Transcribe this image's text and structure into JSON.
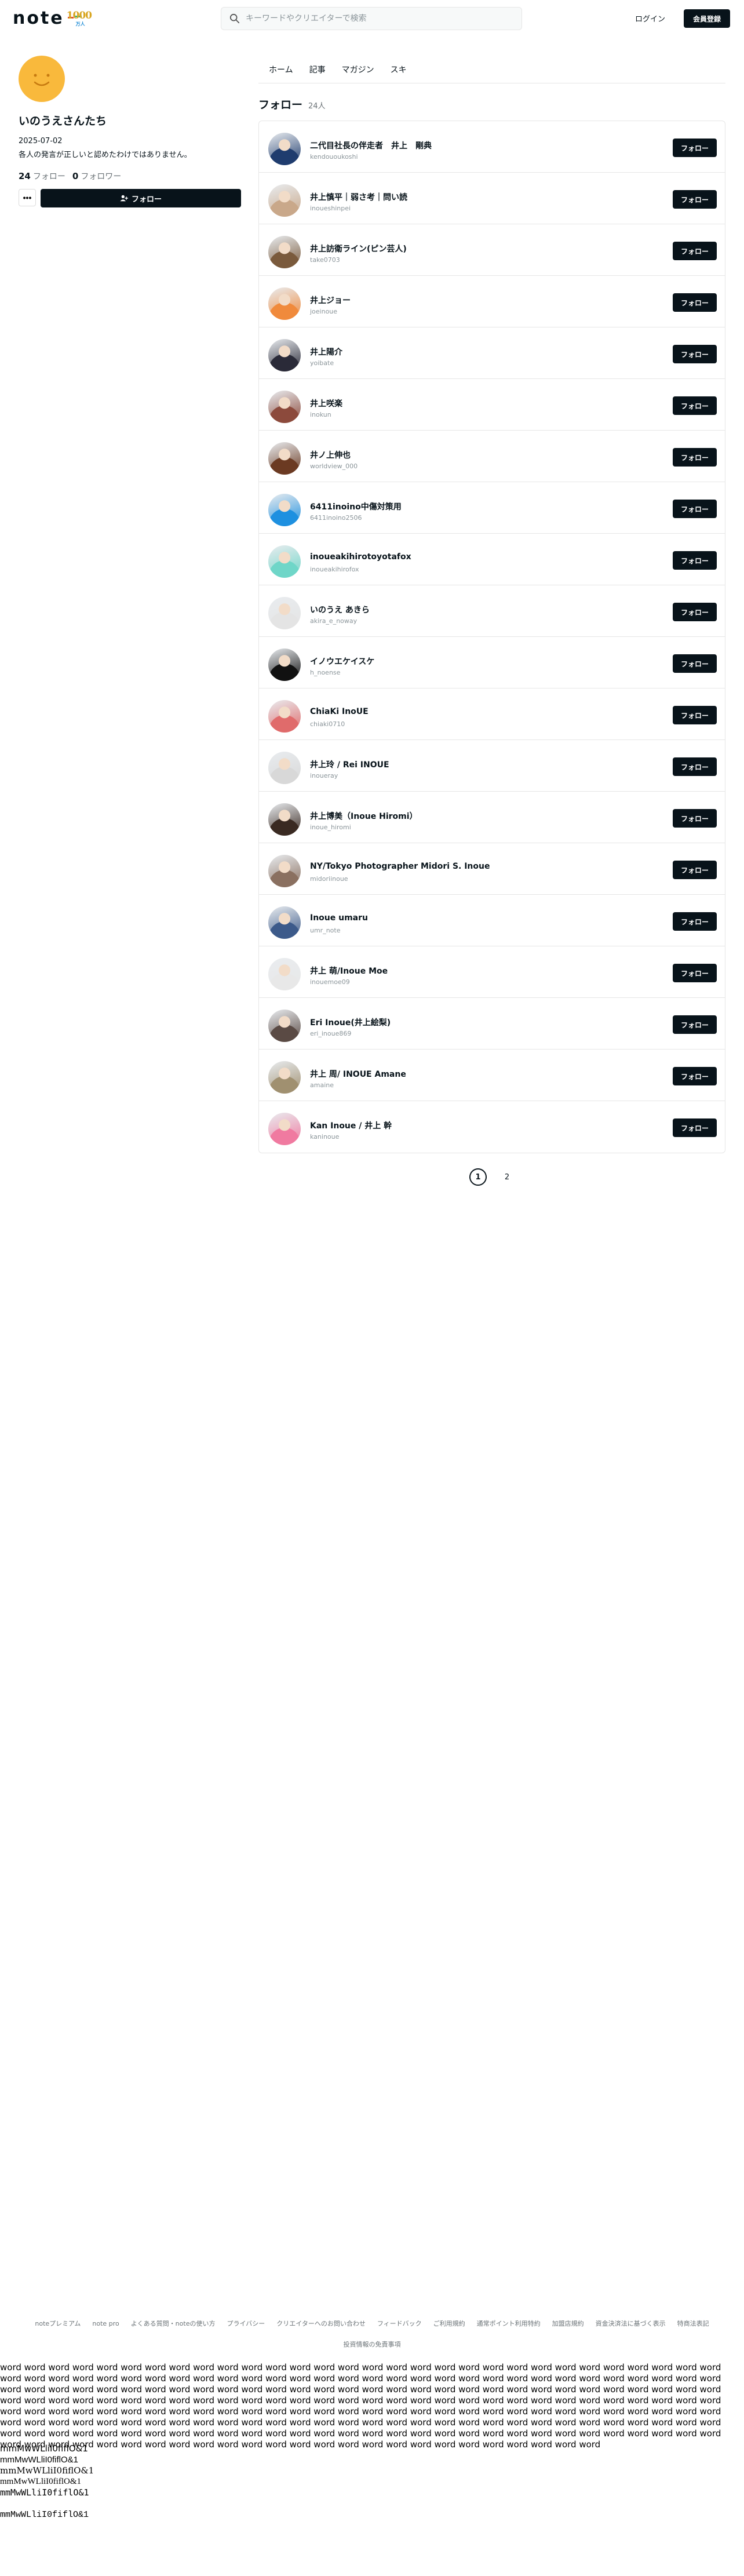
{
  "header": {
    "logo_text": "note",
    "logo_badge_num": "1000",
    "logo_badge_sub": "万人",
    "search_placeholder": "キーワードやクリエイターで検索",
    "login_label": "ログイン",
    "signup_label": "会員登録"
  },
  "profile": {
    "name": "いのうえさんたち",
    "date": "2025-07-02",
    "bio": "各人の発言が正しいと認めたわけではありません。",
    "following_count": "24",
    "following_label": "フォロー",
    "followers_count": "0",
    "followers_label": "フォロワー",
    "more_label": "•••",
    "follow_label": "フォロー"
  },
  "tabs": [
    "ホーム",
    "記事",
    "マガジン",
    "スキ"
  ],
  "section": {
    "title": "フォロー",
    "count": "24人"
  },
  "follow_button_label": "フォロー",
  "follows": [
    {
      "name": "二代目社長の伴走者　井上　剛典",
      "id": "kendououkoshi",
      "avatar_color": "#1f3c6e"
    },
    {
      "name": "井上慎平｜弱さ考｜問い読",
      "id": "inoueshinpei",
      "avatar_color": "#c9a88a"
    },
    {
      "name": "井上訪衛ライン(ピン芸人)",
      "id": "take0703",
      "avatar_color": "#7a5a3c"
    },
    {
      "name": "井上ジョー",
      "id": "joeinoue",
      "avatar_color": "#f08a3c"
    },
    {
      "name": "井上陽介",
      "id": "yoibate",
      "avatar_color": "#2a2a38"
    },
    {
      "name": "井上咲楽",
      "id": "inokun",
      "avatar_color": "#8c4a3c"
    },
    {
      "name": "井ノ上伸也",
      "id": "worldview_000",
      "avatar_color": "#6b3a22"
    },
    {
      "name": "6411inoino中傷対策用",
      "id": "6411inoino2506",
      "avatar_color": "#1e90e0"
    },
    {
      "name": "inoueakihirotoyotafox",
      "id": "inoueakihirofox",
      "avatar_color": "#6fd6c8"
    },
    {
      "name": "いのうえ あきら",
      "id": "akira_e_noway",
      "avatar_color": "#e4e4e4"
    },
    {
      "name": "イノウエケイスケ",
      "id": "h_noense",
      "avatar_color": "#111111"
    },
    {
      "name": "ChiaKi InoUE",
      "id": "chiaki0710",
      "avatar_color": "#e06b6b"
    },
    {
      "name": "井上玲 / Rei INOUE",
      "id": "inoueray",
      "avatar_color": "#d8d8d8"
    },
    {
      "name": "井上博美（Inoue Hiromi）",
      "id": "inoue_hiromi",
      "avatar_color": "#3a2a22"
    },
    {
      "name": "NY/Tokyo Photographer Midori S. Inoue",
      "id": "midoriinoue",
      "avatar_color": "#8a7060"
    },
    {
      "name": "Inoue umaru",
      "id": "umr_note",
      "avatar_color": "#3c5a8a"
    },
    {
      "name": "井上 萌/Inoue Moe",
      "id": "inouemoe09",
      "avatar_color": "#e8e8e8"
    },
    {
      "name": "Eri Inoue(井上絵梨)",
      "id": "eri_inoue869",
      "avatar_color": "#5a4a44"
    },
    {
      "name": "井上 周/ INOUE Amane",
      "id": "amaine",
      "avatar_color": "#a09070"
    },
    {
      "name": "Kan Inoue / 井上 幹",
      "id": "kaninoue",
      "avatar_color": "#f07aa0"
    }
  ],
  "pagination": {
    "pages": [
      "1",
      "2"
    ],
    "current": "1"
  },
  "footer": {
    "links": [
      "noteプレミアム",
      "note pro",
      "よくある質問・noteの使い方",
      "プライバシー",
      "クリエイターへのお問い合わせ",
      "フィードバック",
      "ご利用規約",
      "通常ポイント利用特約",
      "加盟店規約",
      "資金決済法に基づく表示",
      "特商法表記",
      "投資情報の免責事項"
    ]
  },
  "filler": {
    "words": "word word word word word word word word word word word word word word word word word word word word word word word word word word word word word word word word word word word word word word word word word word word word word word word word word word word word word word word word word word word word word word word word word word word word word word word word word word word word word word word word word word word word word word word word word word word word word word word word word word word word word word word word word word word word word word word word word word word word word word word word word word word word word word word word word word word word word word word word word word word word word word word word word word word word word word word word word word word word word word word word word word word word word word word word word word word word word word word word word word word word word word word word word word word word word word word word word word word word word word word word word word word word word word word word word word word word word word word word word word word word word word word word word word word word word word word word word word word",
    "lines": [
      "mmMwWLliI0fiflO&1",
      "mmMwWLliI0fiflO&1",
      "mmMwWLliI0fiflO&1",
      "mmMwWLliI0fiflO&1",
      "mmMwWLliI0fiflO&1",
      "mmMwWLliI0fiflO&1"
    ]
  }
}
